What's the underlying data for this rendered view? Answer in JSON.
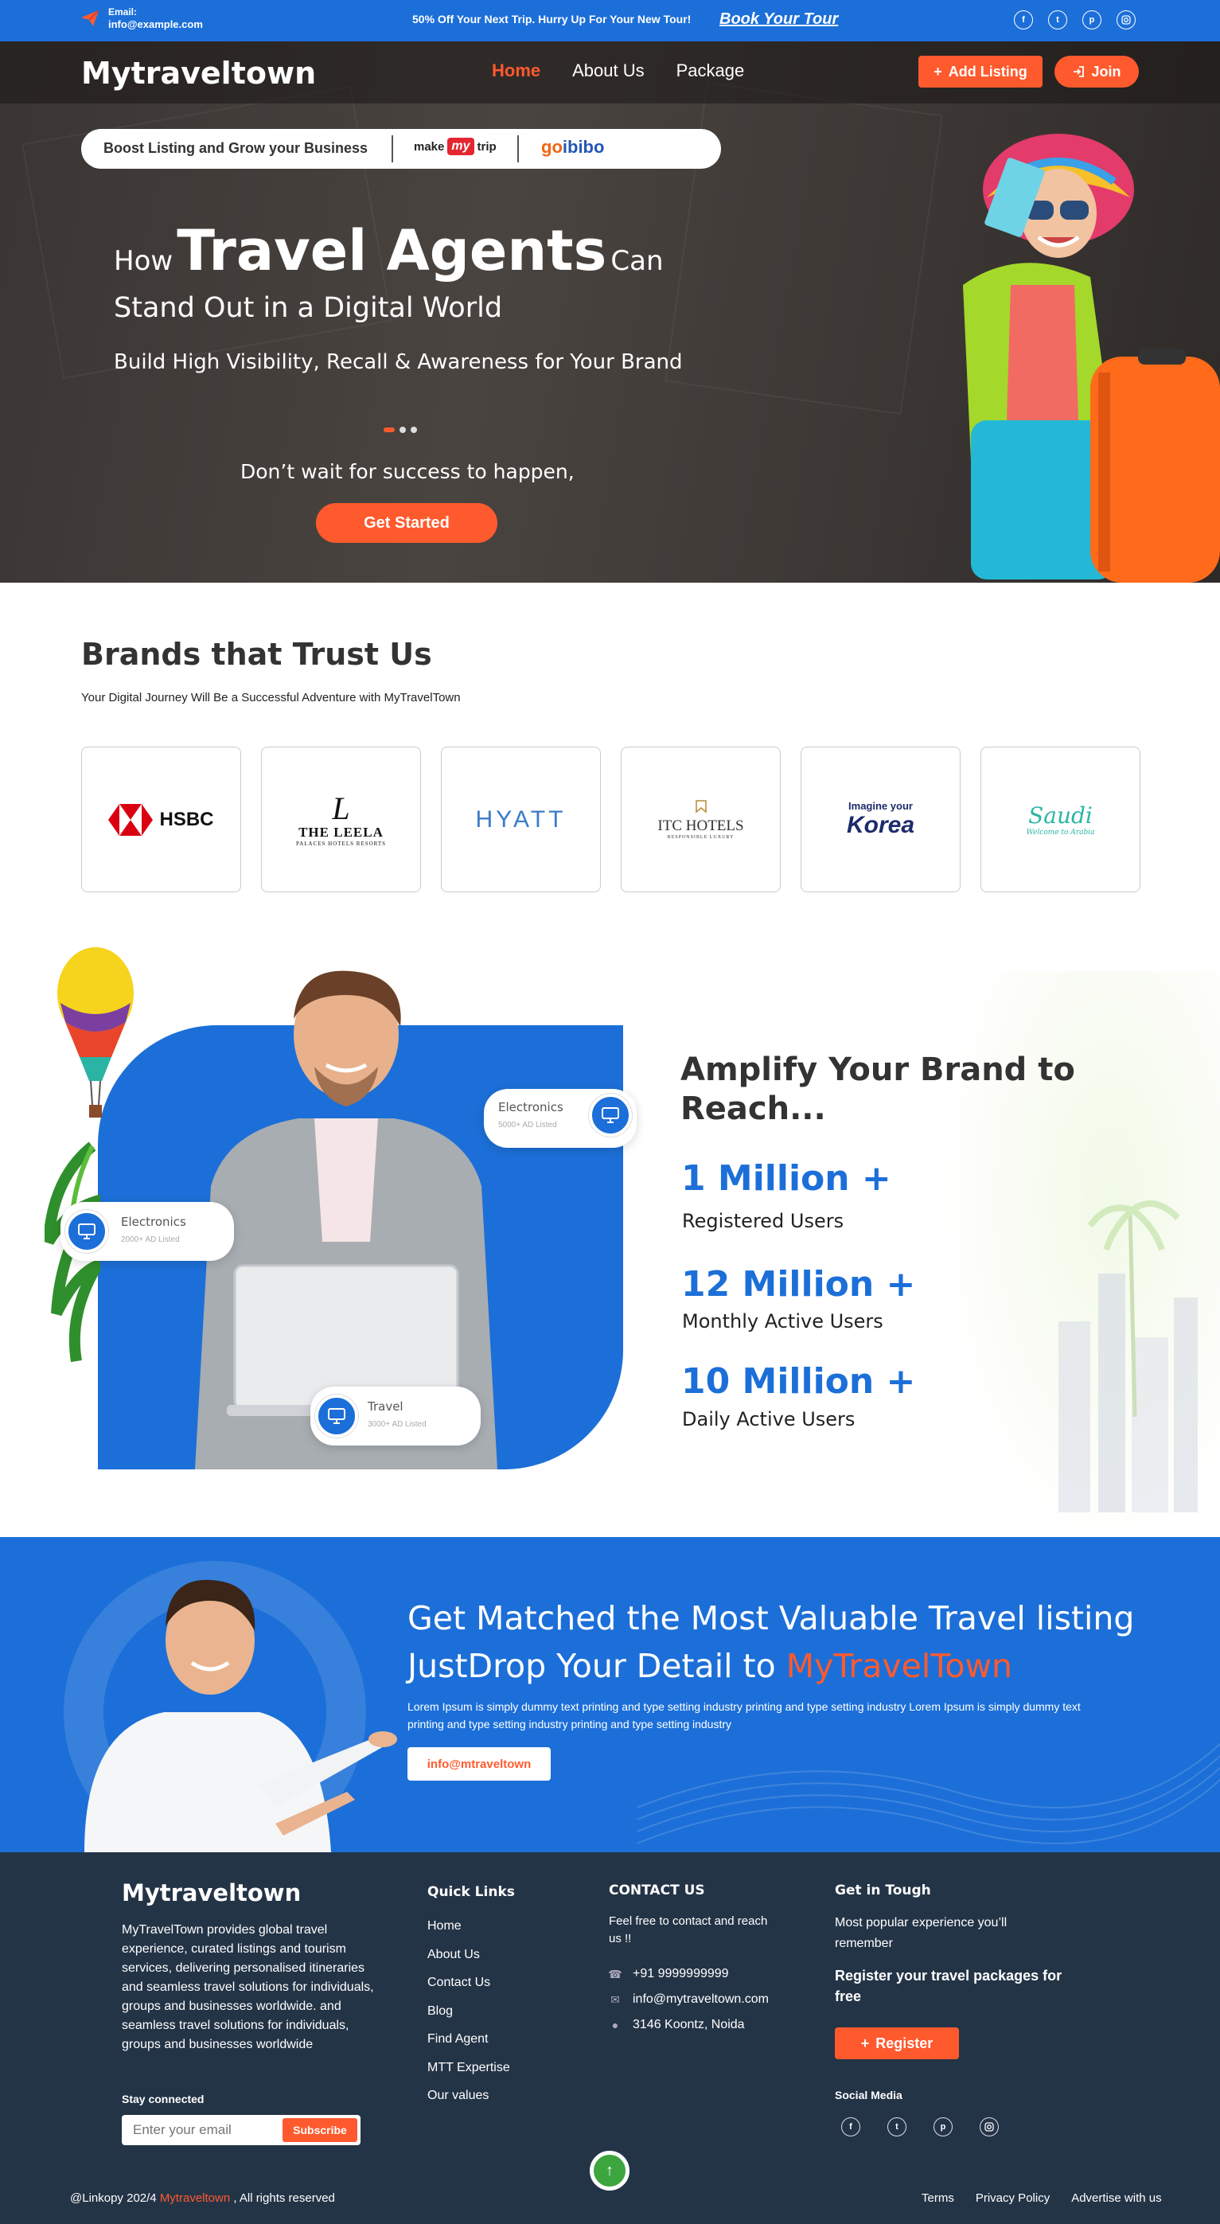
{
  "topbar": {
    "email_label": "Email:",
    "email_value": "info@example.com",
    "promo": "50% Off Your Next Trip. Hurry Up For Your New Tour!",
    "book_link": "Book Your Tour",
    "social_icons": [
      "facebook-icon",
      "twitter-icon",
      "pinterest-icon",
      "instagram-icon"
    ]
  },
  "nav": {
    "logo": "Mytraveltown",
    "items": [
      "Home",
      "About Us",
      "Package"
    ],
    "active": "Home",
    "add_listing": "Add Listing",
    "join": "Join"
  },
  "hero": {
    "boost_text": "Boost Listing and Grow your Business",
    "partner1_a": "make",
    "partner1_b": "my",
    "partner1_c": "trip",
    "partner2_a": "go",
    "partner2_b": "ibibo",
    "headline_how": "How",
    "headline_big": "Travel Agents",
    "headline_can": "Can",
    "headline_line2": "Stand Out in a Digital World",
    "headline_line3": "Build High Visibility, Recall & Awareness for Your Brand",
    "carousel_active": 1,
    "carousel_count": 3,
    "tagline": "Don’t wait for success to happen,",
    "cta": "Get Started"
  },
  "brands": {
    "title": "Brands that Trust Us",
    "subtitle": "Your Digital Journey Will Be a Successful Adventure with MyTravelTown",
    "hsbc": "HSBC",
    "leela_mark": "L",
    "leela_name": "THE LEELA",
    "leela_sub": "PALACES HOTELS RESORTS",
    "hyatt": "HYATT",
    "itc_name": "ITC HOTELS",
    "itc_sub": "RESPONSIBLE LUXURY",
    "korea_a": "Imagine your",
    "korea_b": "Korea",
    "saudi": "Saudi",
    "saudi_sub": "Welcome to Arabia"
  },
  "amplify": {
    "title": "Amplify Your Brand to Reach...",
    "chip1_title": "Electronics",
    "chip1_sub": "5000+ AD Listed",
    "chip2_title": "Electronics",
    "chip2_sub": "2000+ AD Listed",
    "chip3_title": "Travel",
    "chip3_sub": "3000+ AD Listed",
    "stats": [
      {
        "value": "1 Million +",
        "label": "Registered Users"
      },
      {
        "value": "12 Million +",
        "label": "Monthly Active Users"
      },
      {
        "value": "10 Million +",
        "label": "Daily Active Users"
      }
    ]
  },
  "matched": {
    "title1": "Get Matched the Most Valuable Travel listing",
    "title2_a": "JustDrop Your Detail to",
    "title2_b": "MyTravelTown",
    "para": "Lorem Ipsum is simply dummy text printing and type setting industry printing and type setting industry Lorem Ipsum is simply dummy text printing and type setting industry printing and type setting industry",
    "email_btn": "info@mtraveltown"
  },
  "footer": {
    "logo": "Mytraveltown",
    "desc": "MyTravelTown provides global travel experience, curated listings and tourism services, delivering personalised itineraries and seamless travel solutions for individuals, groups and businesses worldwide.  and seamless travel solutions for individuals, groups and businesses worldwide",
    "stay": "Stay connected",
    "email_placeholder": "Enter your email",
    "subscribe": "Subscribe",
    "quick_title": "Quick Links",
    "quick_links": [
      "Home",
      "About Us",
      "Contact Us",
      "Blog",
      "Find Agent",
      "MTT Expertise",
      "Our values"
    ],
    "contact_title": "CONTACT US",
    "contact_text": "Feel free to contact and reach us !!",
    "phone": "+91 9999999999",
    "email": "info@mytraveltown.com",
    "address": "3146 Koontz, Noida",
    "tough_title": "Get in Tough",
    "tough_text": "Most popular experience you’ll remember",
    "tough_bold": "Register your travel packages for free",
    "register": "Register",
    "social_title": "Social Media",
    "copy_a": "@Linkopy 202/4",
    "copy_b": "Mytraveltown",
    "copy_c": ", All rights reserved",
    "bottom_links": [
      "Terms",
      "Privacy Policy",
      "Advertise with us"
    ]
  },
  "colors": {
    "primary_blue": "#1c6fd8",
    "accent_orange": "#ff5a2e",
    "footer_bg": "#243447"
  }
}
